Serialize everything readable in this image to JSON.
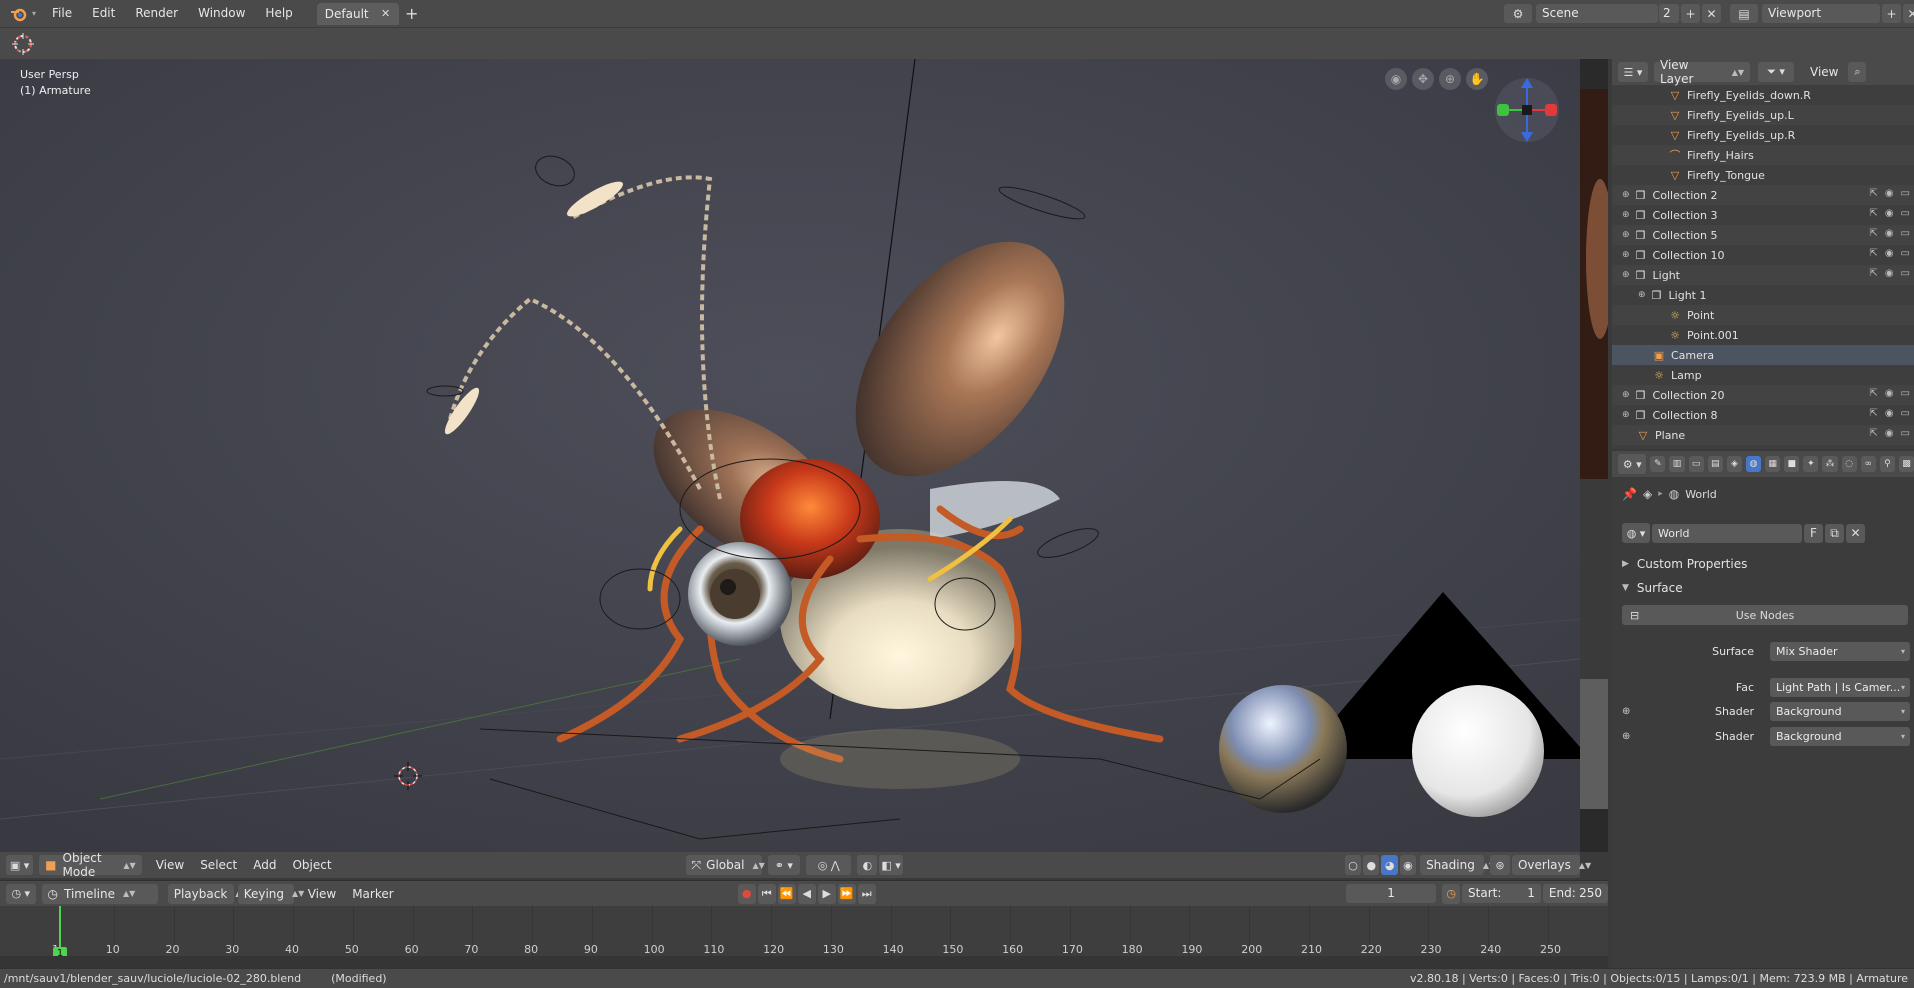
{
  "topbar": {
    "menus": [
      "File",
      "Edit",
      "Render",
      "Window",
      "Help"
    ],
    "workspace_tab": "Default",
    "scene_name": "Scene",
    "scene_count": "2",
    "viewlayer_name": "Viewport"
  },
  "viewport": {
    "perspective_label": "User Persp",
    "active_object_label": "(1) Armature"
  },
  "viewport_header": {
    "mode": "Object Mode",
    "menus": [
      "View",
      "Select",
      "Add",
      "Object"
    ],
    "transform_orientation": "Global",
    "shading_label": "Shading",
    "overlays_label": "Overlays"
  },
  "timeline_header": {
    "editor": "Timeline",
    "playback": "Playback",
    "keying": "Keying",
    "menus": [
      "View",
      "Marker"
    ],
    "current_frame": "1",
    "start_label": "Start:",
    "start_value": "1",
    "end_label": "End:",
    "end_value": "250"
  },
  "timeline": {
    "frame_ticks": [
      "1",
      "10",
      "20",
      "30",
      "40",
      "50",
      "60",
      "70",
      "80",
      "90",
      "100",
      "110",
      "120",
      "130",
      "140",
      "150",
      "160",
      "170",
      "180",
      "190",
      "200",
      "210",
      "220",
      "230",
      "240",
      "250"
    ],
    "current_frame_marker": "1"
  },
  "outliner": {
    "display_mode": "View Layer",
    "view_menu": "View",
    "items": [
      {
        "name": "Firefly_Eyelids_down.R",
        "icon": "mesh-icon",
        "depth": 3
      },
      {
        "name": "Firefly_Eyelids_up.L",
        "icon": "mesh-icon",
        "depth": 3
      },
      {
        "name": "Firefly_Eyelids_up.R",
        "icon": "mesh-icon",
        "depth": 3
      },
      {
        "name": "Firefly_Hairs",
        "icon": "curve-icon",
        "depth": 3
      },
      {
        "name": "Firefly_Tongue",
        "icon": "mesh-icon",
        "depth": 3
      },
      {
        "name": "Collection 2",
        "icon": "collection-icon",
        "depth": 1
      },
      {
        "name": "Collection 3",
        "icon": "collection-icon",
        "depth": 1
      },
      {
        "name": "Collection 5",
        "icon": "collection-icon",
        "depth": 1
      },
      {
        "name": "Collection 10",
        "icon": "collection-icon",
        "depth": 1
      },
      {
        "name": "Light",
        "icon": "collection-icon",
        "depth": 1
      },
      {
        "name": "Light 1",
        "icon": "collection-icon",
        "depth": 2
      },
      {
        "name": "Point",
        "icon": "light-icon",
        "depth": 3
      },
      {
        "name": "Point.001",
        "icon": "light-icon",
        "depth": 3
      },
      {
        "name": "Camera",
        "icon": "camera-icon",
        "depth": 2
      },
      {
        "name": "Lamp",
        "icon": "light-icon",
        "depth": 2
      },
      {
        "name": "Collection 20",
        "icon": "collection-icon",
        "depth": 1
      },
      {
        "name": "Collection 8",
        "icon": "collection-icon",
        "depth": 1
      },
      {
        "name": "Plane",
        "icon": "mesh-icon",
        "depth": 1
      }
    ]
  },
  "properties": {
    "breadcrumb": "World",
    "world_name": "World",
    "fake_user_label": "F",
    "panels": {
      "custom_properties": "Custom Properties",
      "surface": "Surface"
    },
    "use_nodes_label": "Use Nodes",
    "rows": [
      {
        "label": "Surface",
        "value": "Mix Shader"
      },
      {
        "label": "Fac",
        "value": "Light Path | Is Camer..."
      },
      {
        "label": "Shader",
        "value": "Background"
      },
      {
        "label": "Shader",
        "value": "Background"
      }
    ]
  },
  "statusbar": {
    "file_path": "/mnt/sauv1/blender_sauv/luciole/luciole-02_280.blend",
    "modified": "(Modified)",
    "stats": "v2.80.18 | Verts:0 | Faces:0 | Tris:0 | Objects:0/15 | Lamps:0/1 | Mem: 723.9 MB | Armature"
  },
  "colors": {
    "accent": "#4877c7",
    "background": "#3f4049",
    "panel": "#4a4a4a",
    "timeline_cursor": "#4ed44e",
    "record": "#e04a3a"
  }
}
